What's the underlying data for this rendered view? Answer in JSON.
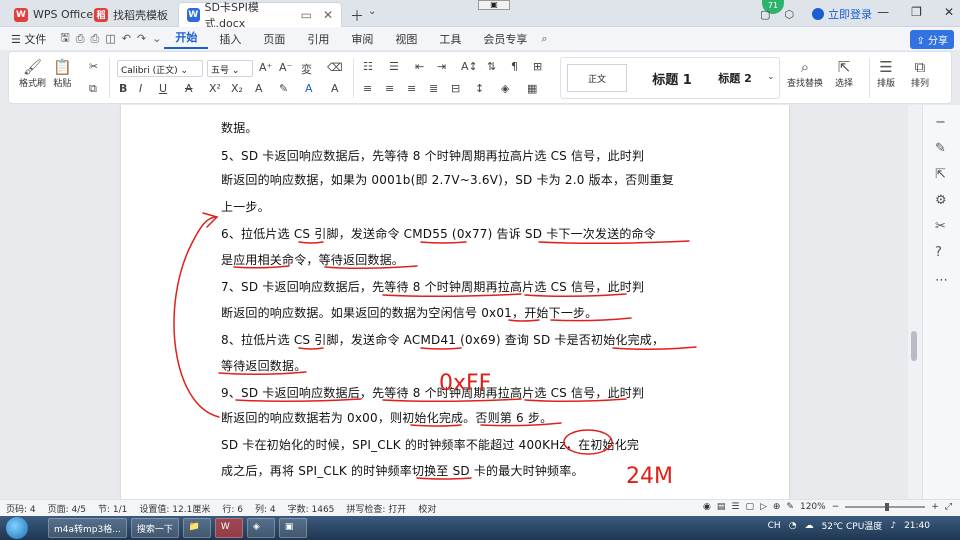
{
  "tabs": [
    {
      "label": "WPS Office",
      "logo": "W",
      "color": "#e0403c"
    },
    {
      "label": "找稻壳模板",
      "logo": "稻",
      "color": "#e0403c"
    },
    {
      "label": "SD卡SPI模式.docx",
      "logo": "W",
      "color": "#2a6ce0"
    }
  ],
  "titlebar": {
    "login": "立即登录",
    "badge": "71"
  },
  "menu": {
    "file": "文件",
    "items": [
      "开始",
      "插入",
      "页面",
      "引用",
      "审阅",
      "视图",
      "工具",
      "会员专享"
    ],
    "share": "分享"
  },
  "ribbon": {
    "format_painter": "格式刷",
    "paste": "粘贴",
    "font_name": "Calibri (正文)",
    "font_size": "五号",
    "style_normal": "正文",
    "style_h1": "标题 1",
    "style_h2": "标题 2",
    "find_replace": "查找替换",
    "select": "选择",
    "sort": "排版",
    "arrange": "排列"
  },
  "document": {
    "lines": [
      "数据。",
      "5、SD 卡返回响应数据后，先等待 8 个时钟周期再拉高片选 CS 信号，此时判",
      "断返回的响应数据，如果为 0001b(即 2.7V~3.6V)，SD 卡为 2.0 版本，否则重复",
      "上一步。",
      "6、拉低片选 CS 引脚，发送命令 CMD55 (0x77) 告诉 SD 卡下一次发送的命令",
      "是应用相关命令，等待返回数据。",
      "7、SD 卡返回响应数据后，先等待 8 个时钟周期再拉高片选 CS 信号，此时判",
      "断返回的响应数据。如果返回的数据为空闲信号 0x01，开始下一步。",
      "8、拉低片选 CS 引脚，发送命令 ACMD41 (0x69) 查询 SD 卡是否初始化完成，",
      "等待返回数据。",
      "9、SD 卡返回响应数据后，先等待 8 个时钟周期再拉高片选 CS 信号，此时判",
      "断返回的响应数据若为 0x00，则初始化完成。否则第 6 步。",
      "    SD 卡在初始化的时候，SPI_CLK 的时钟频率不能超过 400KHz，在初始化完",
      "成之后，再将 SPI_CLK 的时钟频率切换至 SD 卡的最大时钟频率。"
    ],
    "handwriting": {
      "hex": "0xFF",
      "speed": "24M"
    }
  },
  "status": {
    "page": "页码: 4",
    "pages": "页面: 4/5",
    "section": "节: 1/1",
    "setting": "设置值: 12.1厘米",
    "row": "行: 6",
    "col": "列: 4",
    "words": "字数: 1465",
    "spell": "拼写检查: 打开",
    "proof": "校对",
    "zoom": "120%"
  },
  "taskbar": {
    "items": [
      "m4a转mp3格...",
      "搜索一下"
    ],
    "temp": "52℃",
    "cpu": "CPU温度",
    "ime": "CH",
    "time": "21:40"
  }
}
